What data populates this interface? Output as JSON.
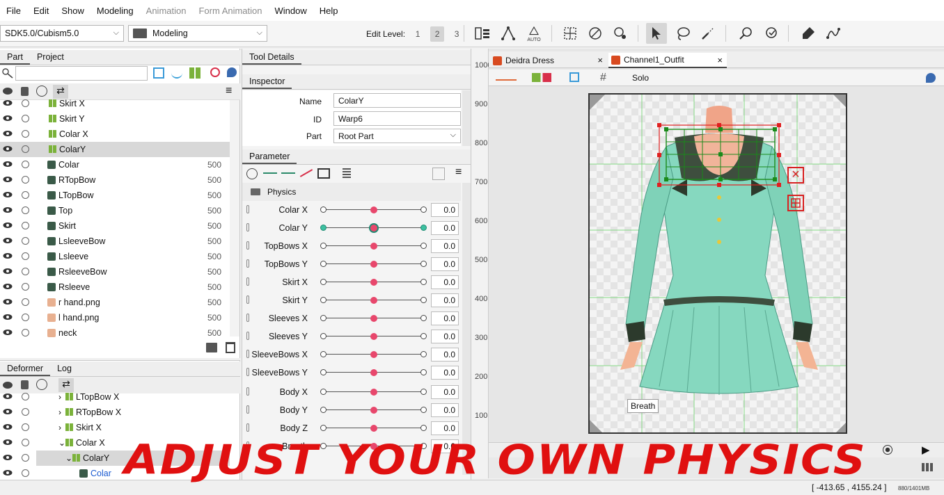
{
  "menu": [
    "File",
    "Edit",
    "Show",
    "Modeling",
    "Animation",
    "Form Animation",
    "Window",
    "Help"
  ],
  "menu_disabled": [
    "Animation",
    "Form Animation"
  ],
  "toolbar": {
    "sdk": "SDK5.0/Cubism5.0",
    "mode": "Modeling",
    "edit_level_label": "Edit Level:",
    "levels": [
      "1",
      "2",
      "3"
    ],
    "active_level": "2",
    "auto_label": "AUTO"
  },
  "left_tabs": {
    "part": "Part",
    "project": "Project"
  },
  "parts": [
    {
      "name": "Skirt X",
      "num": "",
      "type": "warp"
    },
    {
      "name": "Skirt Y",
      "num": "",
      "type": "warp"
    },
    {
      "name": "Colar X",
      "num": "",
      "type": "warp"
    },
    {
      "name": "ColarY",
      "num": "",
      "type": "warp",
      "selected": true
    },
    {
      "name": "Colar",
      "num": "500",
      "type": "art"
    },
    {
      "name": "RTopBow",
      "num": "500",
      "type": "art"
    },
    {
      "name": "LTopBow",
      "num": "500",
      "type": "art"
    },
    {
      "name": "Top",
      "num": "500",
      "type": "art"
    },
    {
      "name": "Skirt",
      "num": "500",
      "type": "art"
    },
    {
      "name": "LsleeveBow",
      "num": "500",
      "type": "art"
    },
    {
      "name": "Lsleeve",
      "num": "500",
      "type": "art"
    },
    {
      "name": "RsleeveBow",
      "num": "500",
      "type": "art"
    },
    {
      "name": "Rsleeve",
      "num": "500",
      "type": "art"
    },
    {
      "name": "r hand.png",
      "num": "500",
      "type": "skin"
    },
    {
      "name": "l hand.png",
      "num": "500",
      "type": "skin"
    },
    {
      "name": "neck",
      "num": "500",
      "type": "skin"
    }
  ],
  "bottom_tabs": {
    "deformer": "Deformer",
    "log": "Log"
  },
  "deformers": [
    {
      "name": "LTopBow X",
      "indent": 0
    },
    {
      "name": "RTopBow X",
      "indent": 0
    },
    {
      "name": "Skirt X",
      "indent": 0
    },
    {
      "name": "Colar X",
      "indent": 0
    },
    {
      "name": "ColarY",
      "indent": 1,
      "selected": true
    },
    {
      "name": "Colar",
      "indent": 2
    }
  ],
  "tool_details": "Tool Details",
  "inspector": {
    "title": "Inspector",
    "name_label": "Name",
    "name": "ColarY",
    "id_label": "ID",
    "id": "Warp6",
    "part_label": "Part",
    "part": "Root Part"
  },
  "parameter": {
    "title": "Parameter",
    "group": "Physics"
  },
  "params": [
    {
      "label": "Colar X",
      "value": "0.0"
    },
    {
      "label": "Colar Y",
      "value": "0.0",
      "active": true
    },
    {
      "label": "TopBows X",
      "value": "0.0"
    },
    {
      "label": "TopBows Y",
      "value": "0.0"
    },
    {
      "label": "Skirt X",
      "value": "0.0"
    },
    {
      "label": "Skirt Y",
      "value": "0.0"
    },
    {
      "label": "Sleeves X",
      "value": "0.0"
    },
    {
      "label": "Sleeves Y",
      "value": "0.0"
    },
    {
      "label": "SleeveBows X",
      "value": "0.0"
    },
    {
      "label": "SleeveBows Y",
      "value": "0.0"
    },
    {
      "label": "Body X",
      "value": "0.0"
    },
    {
      "label": "Body Y",
      "value": "0.0"
    },
    {
      "label": "Body Z",
      "value": "0.0"
    },
    {
      "label": "Breath",
      "value": "0.0"
    }
  ],
  "views": {
    "tab1": "Deidra Dress",
    "tab2": "Channel1_Outfit",
    "solo": "Solo"
  },
  "ruler": [
    "1000",
    "900",
    "800",
    "700",
    "600",
    "500",
    "400",
    "300",
    "200",
    "100"
  ],
  "tooltip": "Breath",
  "status": {
    "coords": "[ -413.65 , 4155.24 ]",
    "memory": "880/1401MB"
  },
  "banner": "ADJUST YOUR OWN PHYSICS",
  "colors": {
    "warp": "#7bb23a",
    "param_knob": "#e8476c",
    "active": "#3cc0a0",
    "banner": "#e01010"
  }
}
